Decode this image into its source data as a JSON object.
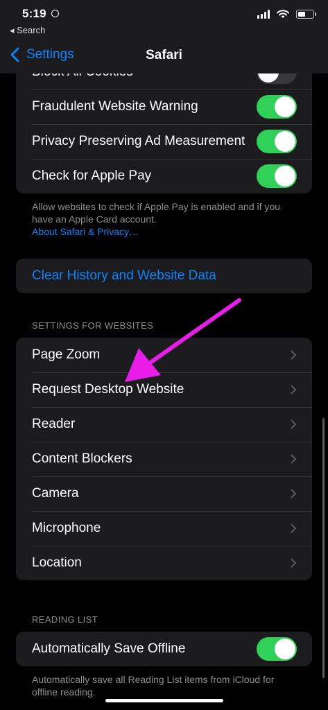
{
  "status_bar": {
    "time": "5:19",
    "back_app": "◂ Search"
  },
  "nav": {
    "back_label": "Settings",
    "title": "Safari"
  },
  "privacy_group": {
    "rows": [
      {
        "label": "Block All Cookies",
        "toggle": "off"
      },
      {
        "label": "Fraudulent Website Warning",
        "toggle": "on"
      },
      {
        "label": "Privacy Preserving Ad Measurement",
        "toggle": "on"
      },
      {
        "label": "Check for Apple Pay",
        "toggle": "on"
      }
    ],
    "footnote": "Allow websites to check if Apple Pay is enabled and if you have an Apple Card account.",
    "footnote_link": "About Safari & Privacy…"
  },
  "clear_history": {
    "label": "Clear History and Website Data"
  },
  "settings_for_websites": {
    "header": "SETTINGS FOR WEBSITES",
    "rows": [
      {
        "label": "Page Zoom"
      },
      {
        "label": "Request Desktop Website"
      },
      {
        "label": "Reader"
      },
      {
        "label": "Content Blockers"
      },
      {
        "label": "Camera"
      },
      {
        "label": "Microphone"
      },
      {
        "label": "Location"
      }
    ]
  },
  "reading_list": {
    "header": "READING LIST",
    "rows": [
      {
        "label": "Automatically Save Offline",
        "toggle": "on"
      }
    ],
    "footnote": "Automatically save all Reading List items from iCloud for offline reading."
  },
  "annotation": {
    "arrow_color": "#e81ee8"
  },
  "colors": {
    "accent": "#0a84ff",
    "toggle_on": "#30d158",
    "group_bg": "#1c1c1e"
  }
}
